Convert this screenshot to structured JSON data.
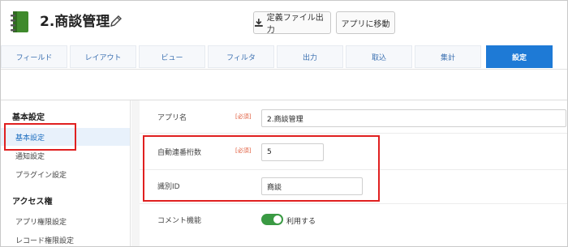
{
  "app": {
    "title": "2.商談管理"
  },
  "header": {
    "export_label": "定義ファイル出力",
    "move_label": "アプリに移動"
  },
  "tabs": [
    {
      "label": "フィールド"
    },
    {
      "label": "レイアウト"
    },
    {
      "label": "ビュー"
    },
    {
      "label": "フィルタ"
    },
    {
      "label": "出力"
    },
    {
      "label": "取込"
    },
    {
      "label": "集計"
    },
    {
      "label": "設定"
    }
  ],
  "sidebar": {
    "section_basic": "基本設定",
    "items_basic": [
      {
        "label": "基本設定"
      },
      {
        "label": "通知設定"
      },
      {
        "label": "プラグイン設定"
      }
    ],
    "section_access": "アクセス権",
    "items_access": [
      {
        "label": "アプリ権限設定"
      },
      {
        "label": "レコード権限設定"
      }
    ]
  },
  "form": {
    "app_name_label": "アプリ名",
    "app_name_required": "[必須]",
    "app_name_value": "2.商談管理",
    "auto_number_label": "自動連番桁数",
    "auto_number_required": "[必須]",
    "auto_number_value": "5",
    "identifier_label": "識別ID",
    "identifier_value": "商談",
    "comment_label": "コメント機能",
    "comment_toggle_label": "利用する",
    "comment_enabled": true
  },
  "colors": {
    "accent": "#1e7ad6",
    "toggle_on": "#3a9a43",
    "highlight": "#e02020",
    "required": "#e05a3a"
  }
}
